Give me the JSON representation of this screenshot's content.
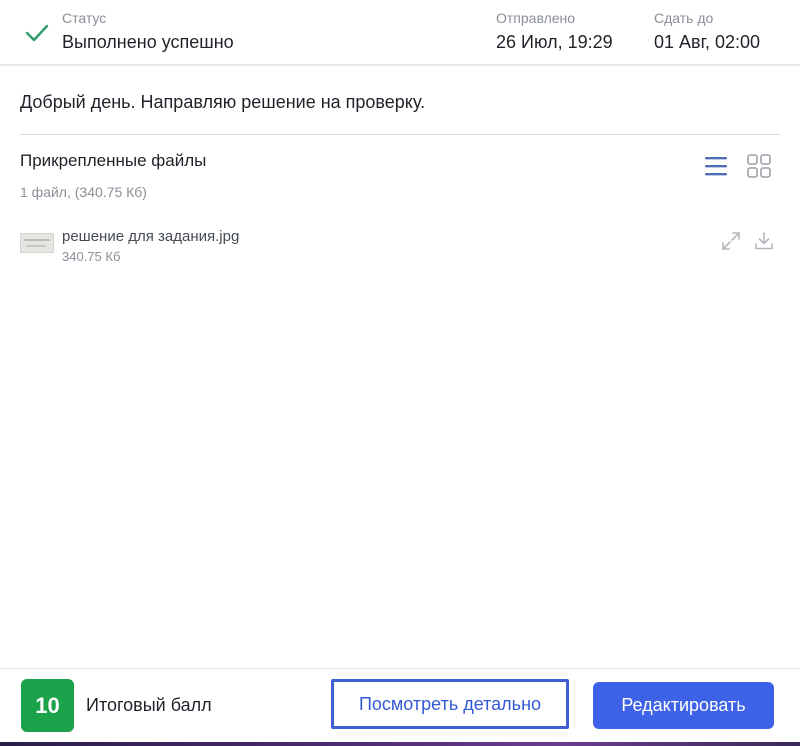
{
  "header": {
    "status_label": "Статус",
    "status_value": "Выполнено успешно",
    "sent_label": "Отправлено",
    "sent_value": "26 Июл, 19:29",
    "due_label": "Сдать до",
    "due_value": "01 Авг, 02:00"
  },
  "message": "Добрый день. Направляю решение на проверку.",
  "attachments": {
    "title": "Прикрепленные файлы",
    "summary": "1 файл, (340.75 Кб)",
    "files": [
      {
        "name": "решение для задания.jpg",
        "size": "340.75 Кб"
      }
    ]
  },
  "footer": {
    "score": "10",
    "score_label": "Итоговый балл",
    "details_button": "Посмотреть детально",
    "edit_button": "Редактировать"
  },
  "icons": {
    "status": "check-icon",
    "list_view": "list-view-icon",
    "grid_view": "grid-view-icon",
    "expand": "expand-icon",
    "download": "download-icon"
  },
  "colors": {
    "success": "#1aa34a",
    "check": "#2e9e6a",
    "accent": "#3d62e7",
    "view_icon_active": "#4a6fb5",
    "view_icon_inactive": "#a7abb2"
  }
}
